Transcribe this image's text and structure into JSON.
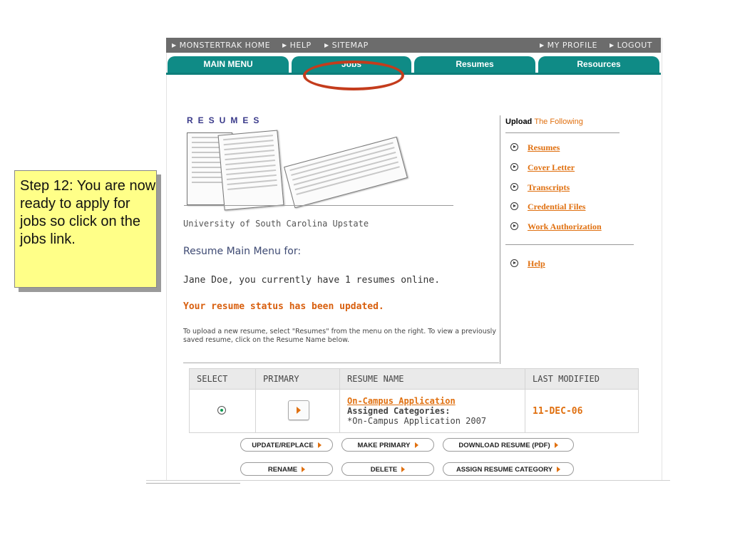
{
  "topnav": {
    "home": "MONSTERTRAK HOME",
    "help": "HELP",
    "sitemap": "SITEMAP",
    "profile": "MY PROFILE",
    "logout": "LOGOUT"
  },
  "tabs": [
    "MAIN MENU",
    "Jobs",
    "Resumes",
    "Resources"
  ],
  "logo_title": "RESUMES",
  "university": "University of South Carolina Upstate",
  "menu_heading": "Resume Main Menu for:",
  "user_line": "Jane Doe, you currently have 1 resumes online.",
  "status_message": "Your resume status has been updated.",
  "instructions": "To upload a new resume, select \"Resumes\" from the menu on the right. To view a previously saved resume, click on the Resume Name below.",
  "upload": {
    "title_bold": "Upload",
    "title_rest": "The Following",
    "links": [
      "Resumes",
      "Cover Letter",
      "Transcripts",
      "Credential Files",
      "Work Authorization"
    ],
    "help": "Help"
  },
  "table": {
    "headers": [
      "SELECT",
      "PRIMARY",
      "RESUME NAME",
      "LAST MODIFIED"
    ],
    "rows": [
      {
        "name": "On-Campus Application",
        "categories_label": "Assigned Categories:",
        "category": "*On-Campus Application 2007",
        "last_modified": "11-DEC-06"
      }
    ]
  },
  "actions": {
    "update": "UPDATE/REPLACE",
    "make_primary": "MAKE PRIMARY",
    "download": "DOWNLOAD RESUME (PDF)",
    "rename": "RENAME",
    "delete": "DELETE",
    "assign": "ASSIGN RESUME CATEGORY"
  },
  "callout": "Step 12: You are now ready to apply for jobs so click on the jobs link.",
  "colors": {
    "tab_teal": "#0f8b86",
    "link_orange": "#e07010",
    "highlight_oval": "#c43c1c",
    "callout_yellow": "#ffff88"
  }
}
